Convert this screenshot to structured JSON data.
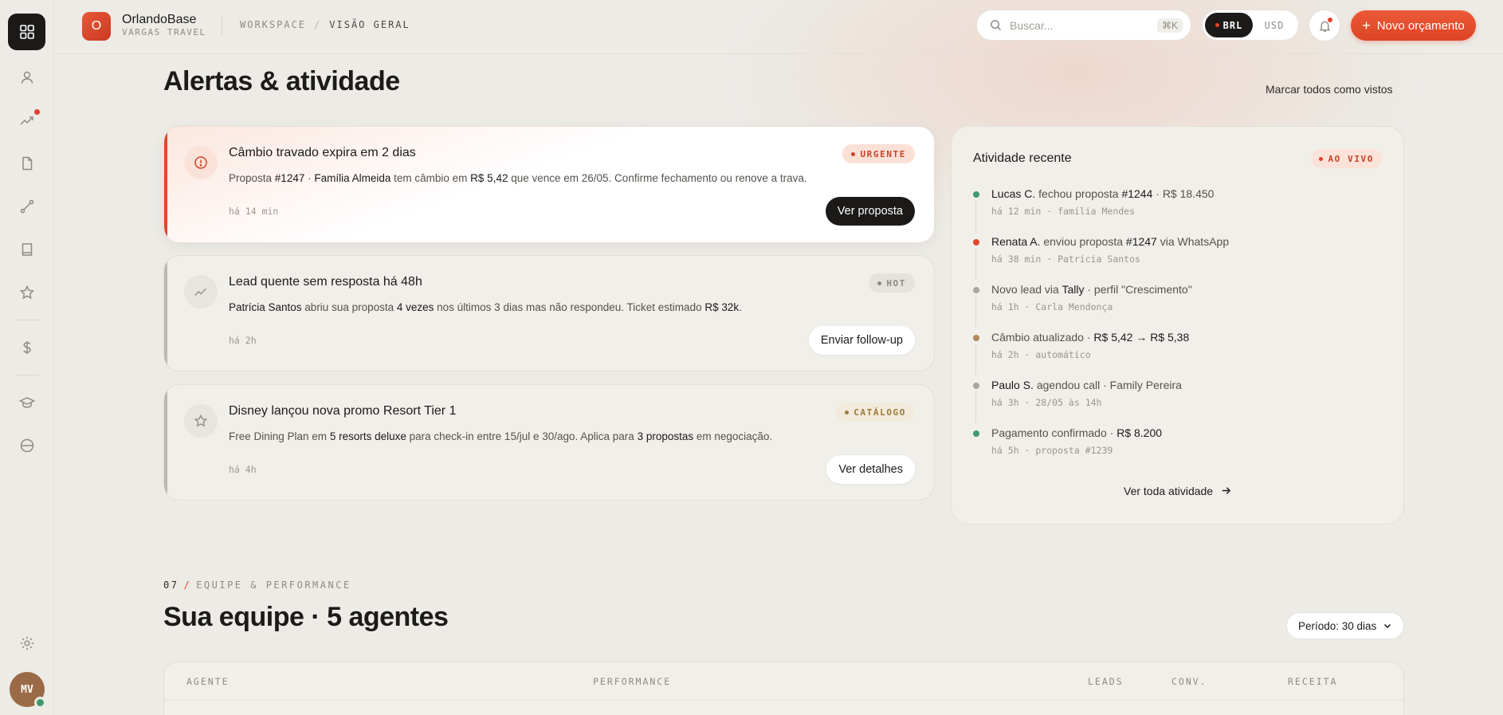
{
  "brand": {
    "initial": "O",
    "name": "OrlandoBase",
    "sub": "VARGAS TRAVEL"
  },
  "breadcrumb": {
    "parent": "WORKSPACE",
    "separator": "/",
    "current": "VISÃO GERAL"
  },
  "search": {
    "placeholder": "Buscar...",
    "shortcut": "⌘K"
  },
  "currency": {
    "active": "BRL",
    "inactive": "USD"
  },
  "new_button": {
    "plus": "+",
    "label": "Novo orçamento"
  },
  "user": {
    "initials": "MV"
  },
  "alerts_section": {
    "title": "Alertas & atividade",
    "mark_all": "Marcar todos como vistos"
  },
  "alerts": [
    {
      "title": "Câmbio travado expira em 2 dias",
      "badge": "URGENTE",
      "desc": [
        {
          "t": "Proposta "
        },
        {
          "t": "#1247",
          "b": true
        },
        {
          "t": " · "
        },
        {
          "t": "Família Almeida",
          "b": true
        },
        {
          "t": " tem câmbio em "
        },
        {
          "t": "R$ 5,42",
          "b": true
        },
        {
          "t": " que vence em 26/05. Confirme fechamento ou renove a trava."
        }
      ],
      "time": "há 14 min",
      "action": "Ver proposta"
    },
    {
      "title": "Lead quente sem resposta há 48h",
      "badge": "HOT",
      "desc": [
        {
          "t": "Patrícia Santos",
          "b": true
        },
        {
          "t": " abriu sua proposta "
        },
        {
          "t": "4 vezes",
          "b": true
        },
        {
          "t": " nos últimos 3 dias mas não respondeu. Ticket estimado "
        },
        {
          "t": "R$ 32k",
          "b": true
        },
        {
          "t": "."
        }
      ],
      "time": "há 2h",
      "action": "Enviar follow-up"
    },
    {
      "title": "Disney lançou nova promo Resort Tier 1",
      "badge": "CATÁLOGO",
      "desc": [
        {
          "t": "Free Dining Plan em "
        },
        {
          "t": "5 resorts deluxe",
          "b": true
        },
        {
          "t": " para check-in entre 15/jul e 30/ago. Aplica para "
        },
        {
          "t": "3 propostas",
          "b": true
        },
        {
          "t": " em negociação."
        }
      ],
      "time": "há 4h",
      "action": "Ver detalhes"
    }
  ],
  "activity": {
    "title": "Atividade recente",
    "live": "AO VIVO",
    "items": [
      {
        "color": "#3f9a6f",
        "main": [
          {
            "t": "Lucas C.",
            "b": true
          },
          {
            "t": " fechou proposta "
          },
          {
            "t": "#1244",
            "b": true
          },
          {
            "t": " · R$ 18.450"
          }
        ],
        "sub": "há 12 min · família Mendes"
      },
      {
        "color": "#e2472b",
        "main": [
          {
            "t": "Renata A.",
            "b": true
          },
          {
            "t": " enviou proposta "
          },
          {
            "t": "#1247",
            "b": true
          },
          {
            "t": " via WhatsApp"
          }
        ],
        "sub": "há 38 min · Patrícia Santos"
      },
      {
        "color": "#a9a6a0",
        "main": [
          {
            "t": "Novo lead via "
          },
          {
            "t": "Tally",
            "b": true
          },
          {
            "t": " · perfil \"Crescimento\""
          }
        ],
        "sub": "há 1h · Carla Mendonça"
      },
      {
        "color": "#b08a5a",
        "main": [
          {
            "t": "Câmbio atualizado · "
          },
          {
            "t": "R$ 5,42 → R$ 5,38",
            "b": true
          }
        ],
        "sub": "há 2h · automático"
      },
      {
        "color": "#a9a6a0",
        "main": [
          {
            "t": "Paulo S.",
            "b": true
          },
          {
            "t": " agendou call · Family Pereira"
          }
        ],
        "sub": "há 3h · 28/05 às 14h"
      },
      {
        "color": "#3f9a6f",
        "main": [
          {
            "t": "Pagamento confirmado · "
          },
          {
            "t": "R$ 8.200",
            "b": true
          }
        ],
        "sub": "há 5h · proposta #1239"
      }
    ],
    "see_all": "Ver toda atividade"
  },
  "team_section": {
    "number": "07",
    "slash": "/",
    "label": "EQUIPE & PERFORMANCE",
    "title": "Sua equipe · 5 agentes",
    "period": "Período: 30 dias",
    "columns": [
      "AGENTE",
      "PERFORMANCE",
      "LEADS",
      "CONV.",
      "RECEITA"
    ]
  }
}
